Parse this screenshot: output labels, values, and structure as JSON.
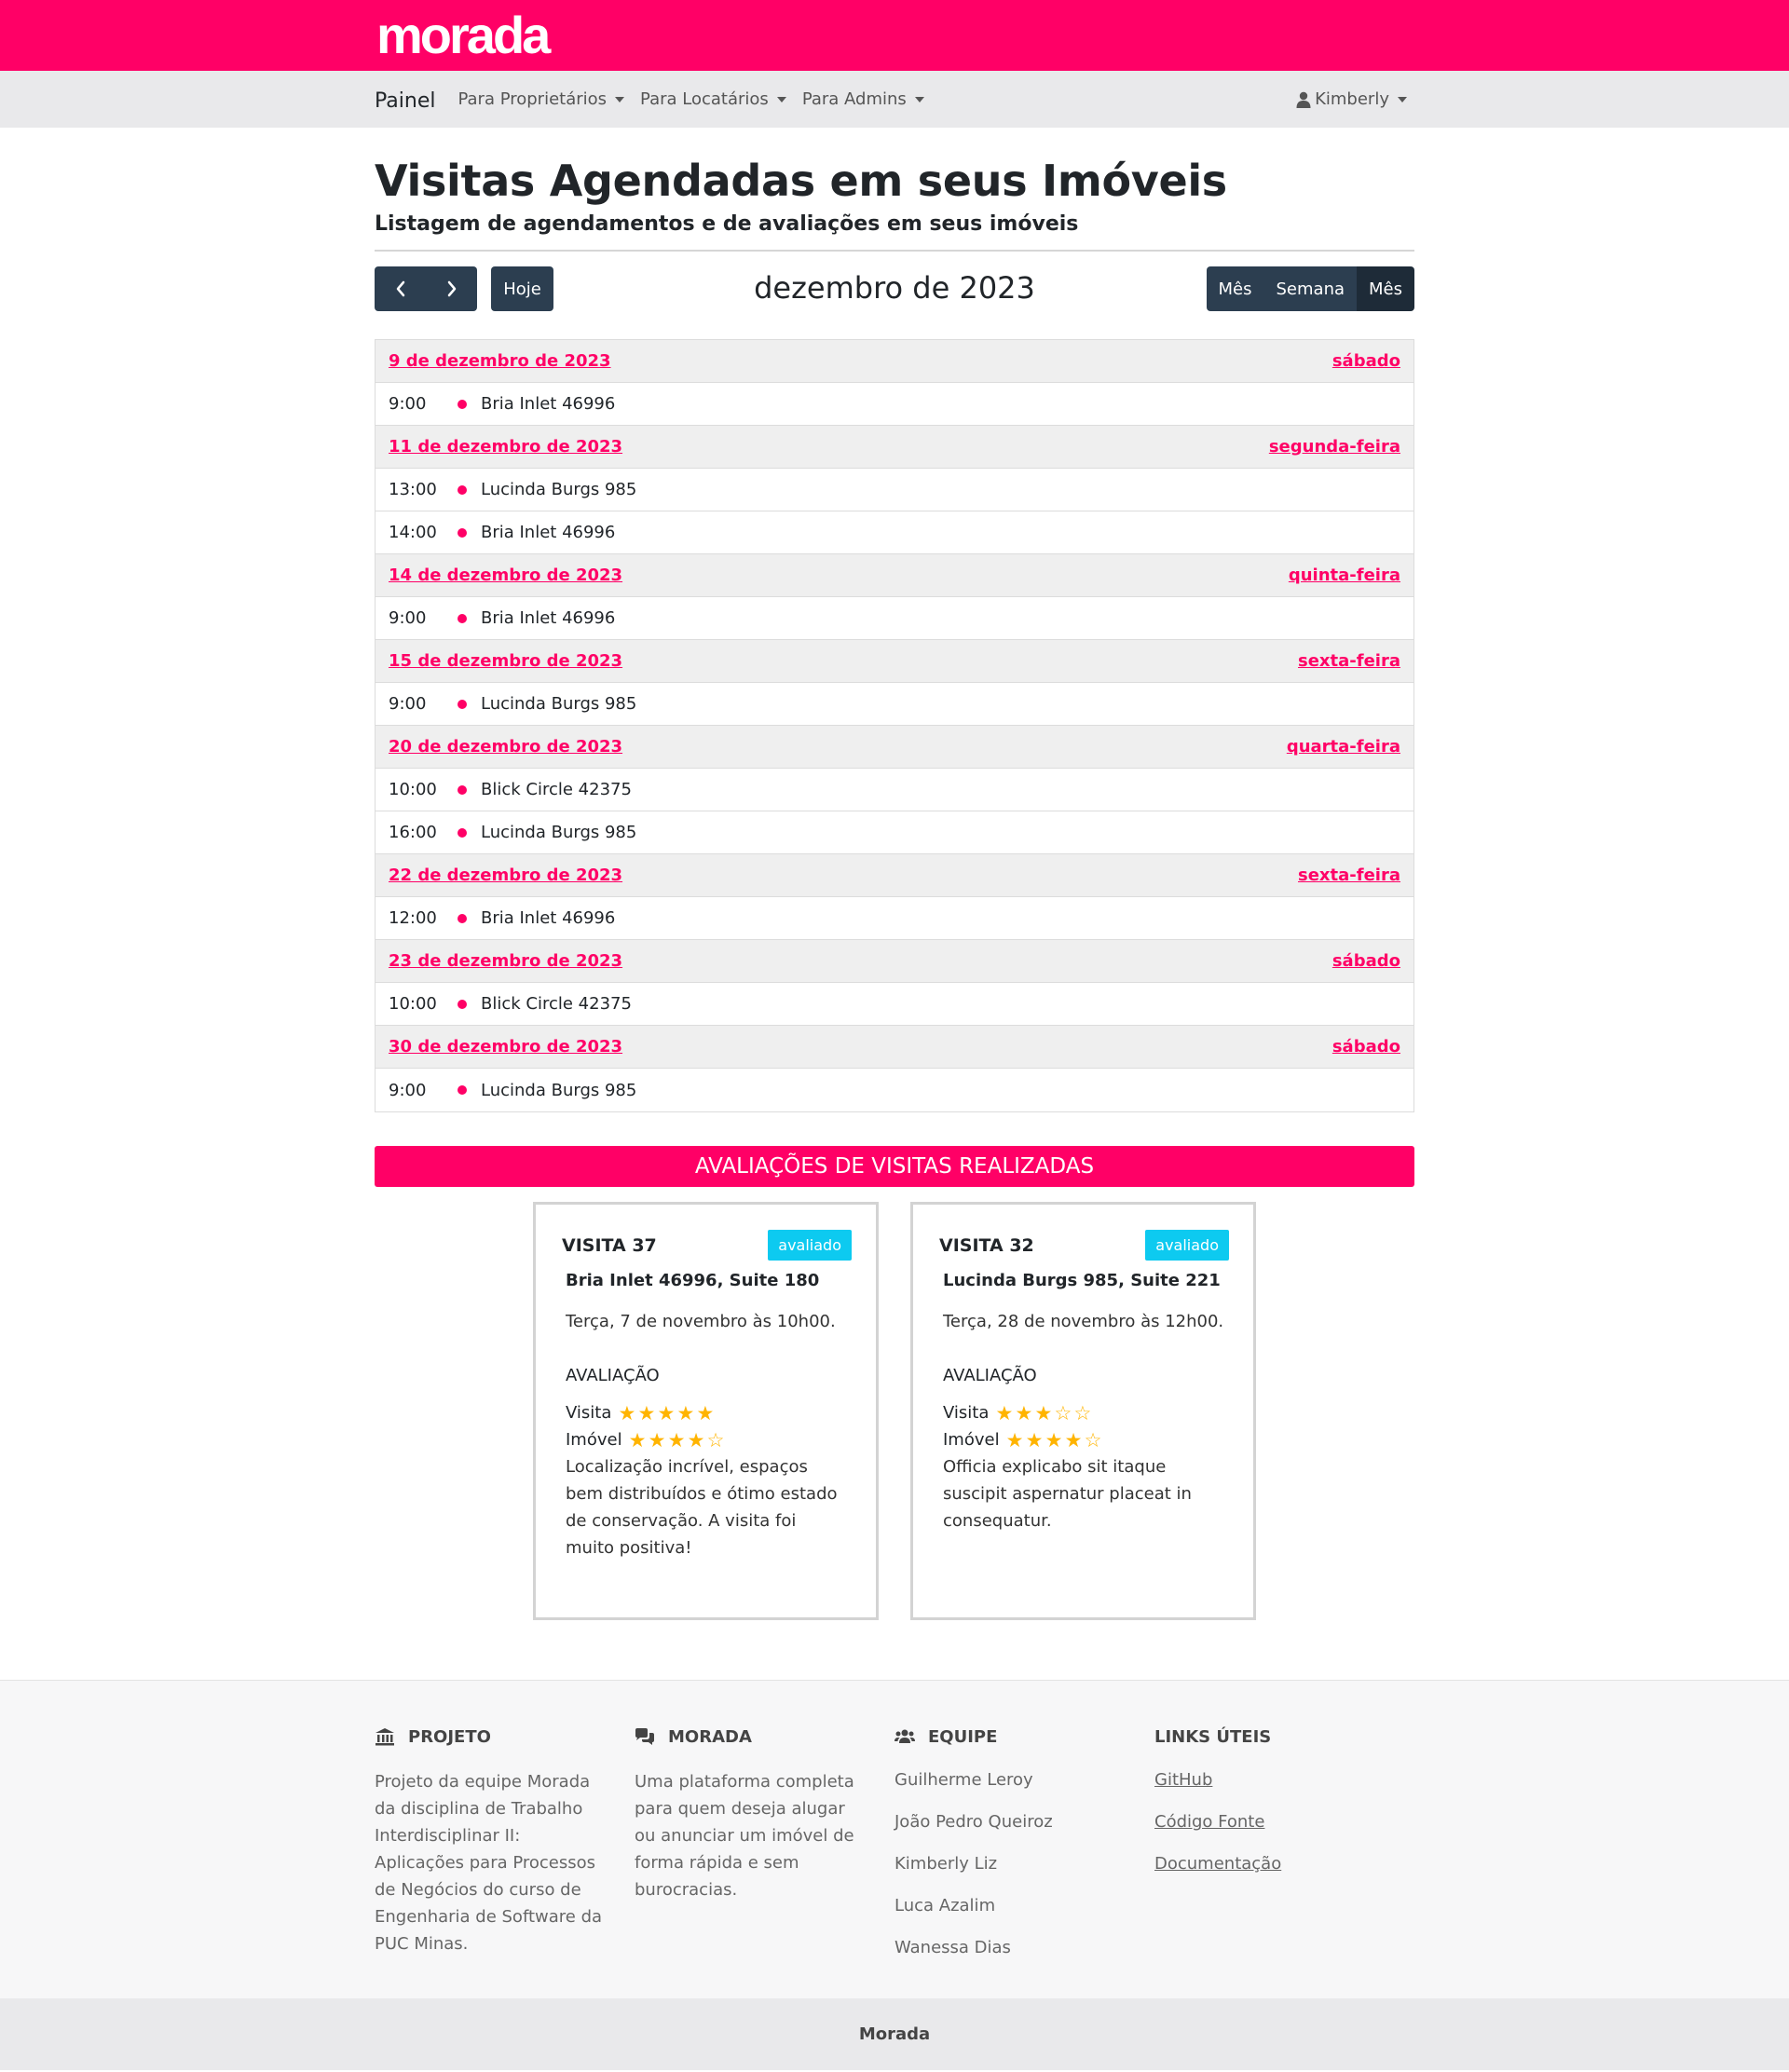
{
  "brand": {
    "logo_text": "morada",
    "color": "#ff0066"
  },
  "nav": {
    "brand": "Painel",
    "items": [
      {
        "label": "Para Proprietários"
      },
      {
        "label": "Para Locatários"
      },
      {
        "label": "Para Admins"
      }
    ],
    "user": "Kimberly"
  },
  "header": {
    "title": "Visitas Agendadas em seus Imóveis",
    "subtitle": "Listagem de agendamentos e de avaliações em seus imóveis"
  },
  "calendar": {
    "title": "dezembro de 2023",
    "today_label": "Hoje",
    "views": [
      "Mês",
      "Semana",
      "Mês"
    ],
    "days": [
      {
        "date": "9 de dezembro de 2023",
        "weekday": "sábado",
        "events": [
          {
            "time": "9:00",
            "title": "Bria Inlet 46996"
          }
        ]
      },
      {
        "date": "11 de dezembro de 2023",
        "weekday": "segunda-feira",
        "events": [
          {
            "time": "13:00",
            "title": "Lucinda Burgs 985"
          },
          {
            "time": "14:00",
            "title": "Bria Inlet 46996"
          }
        ]
      },
      {
        "date": "14 de dezembro de 2023",
        "weekday": "quinta-feira",
        "events": [
          {
            "time": "9:00",
            "title": "Bria Inlet 46996"
          }
        ]
      },
      {
        "date": "15 de dezembro de 2023",
        "weekday": "sexta-feira",
        "events": [
          {
            "time": "9:00",
            "title": "Lucinda Burgs 985"
          }
        ]
      },
      {
        "date": "20 de dezembro de 2023",
        "weekday": "quarta-feira",
        "events": [
          {
            "time": "10:00",
            "title": "Blick Circle 42375"
          },
          {
            "time": "16:00",
            "title": "Lucinda Burgs 985"
          }
        ]
      },
      {
        "date": "22 de dezembro de 2023",
        "weekday": "sexta-feira",
        "events": [
          {
            "time": "12:00",
            "title": "Bria Inlet 46996"
          }
        ]
      },
      {
        "date": "23 de dezembro de 2023",
        "weekday": "sábado",
        "events": [
          {
            "time": "10:00",
            "title": "Blick Circle 42375"
          }
        ]
      },
      {
        "date": "30 de dezembro de 2023",
        "weekday": "sábado",
        "events": [
          {
            "time": "9:00",
            "title": "Lucinda Burgs 985"
          }
        ]
      }
    ]
  },
  "reviews": {
    "banner": "AVALIAÇÕES DE VISITAS REALIZADAS",
    "cards": [
      {
        "title": "VISITA 37",
        "badge": "avaliado",
        "address": "Bria Inlet 46996, Suite 180",
        "date": "Terça, 7 de novembro às 10h00.",
        "eval_label": "AVALIAÇÃO",
        "visit_label": "Visita",
        "visit_rating": 5,
        "property_label": "Imóvel",
        "property_rating": 4,
        "comment": "Localização incrível, espaços bem distribuídos e ótimo estado de conservação. A visita foi muito positiva!"
      },
      {
        "title": "VISITA 32",
        "badge": "avaliado",
        "address": "Lucinda Burgs 985, Suite 221",
        "date": "Terça, 28 de novembro às 12h00.",
        "eval_label": "AVALIAÇÃO",
        "visit_label": "Visita",
        "visit_rating": 3,
        "property_label": "Imóvel",
        "property_rating": 4,
        "comment": "Officia explicabo sit itaque suscipit aspernatur placeat in consequatur."
      }
    ]
  },
  "footer": {
    "projeto": {
      "title": "PROJETO",
      "text": "Projeto da equipe Morada da disciplina de Trabalho Interdisciplinar II: Aplicações para Processos de Negócios do curso de Engenharia de Software da PUC Minas."
    },
    "morada": {
      "title": "MORADA",
      "text": "Uma plataforma completa para quem deseja alugar ou anunciar um imóvel de forma rápida e sem burocracias."
    },
    "equipe": {
      "title": "EQUIPE",
      "members": [
        "Guilherme Leroy",
        "João Pedro Queiroz",
        "Kimberly Liz",
        "Luca Azalim",
        "Wanessa Dias"
      ]
    },
    "links": {
      "title": "LINKS ÚTEIS",
      "items": [
        "GitHub",
        "Código Fonte",
        "Documentação"
      ]
    },
    "bottom": "Morada"
  }
}
